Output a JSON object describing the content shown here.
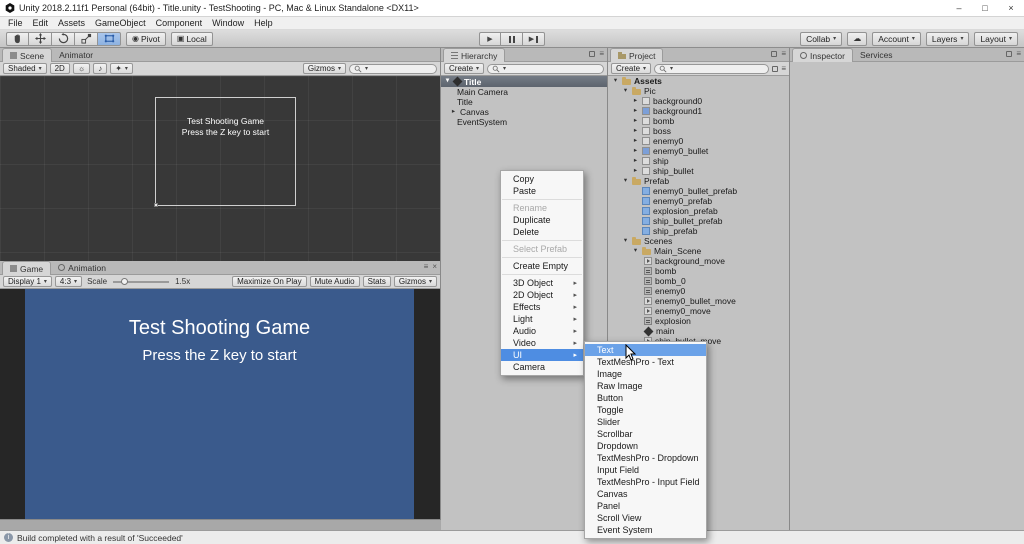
{
  "window": {
    "title": "Unity 2018.2.11f1 Personal (64bit) - Title.unity - TestShooting - PC, Mac & Linux Standalone <DX11>"
  },
  "menubar": {
    "items": [
      "File",
      "Edit",
      "Assets",
      "GameObject",
      "Component",
      "Window",
      "Help"
    ]
  },
  "toolbar": {
    "pivot_label": "Pivot",
    "local_label": "Local",
    "collab_label": "Collab",
    "account_label": "Account",
    "layers_label": "Layers",
    "layout_label": "Layout"
  },
  "scene_panel": {
    "tab": "Scene",
    "animator_tab": "Animator",
    "shaded_label": "Shaded",
    "mode_2d": "2D",
    "gizmos_label": "Gizmos",
    "overlay": {
      "line1": "Test Shooting Game",
      "line2": "Press the Z key to start"
    }
  },
  "game_panel": {
    "tab": "Game",
    "animation_tab": "Animation",
    "display_label": "Display 1",
    "aspect_label": "4:3",
    "scale_label": "Scale",
    "scale_value": "1.5x",
    "maximize_label": "Maximize On Play",
    "mute_label": "Mute Audio",
    "stats_label": "Stats",
    "gizmos_label": "Gizmos",
    "view": {
      "line1": "Test Shooting Game",
      "line2": "Press the Z key to start",
      "bg_color": "#3a5a8c"
    }
  },
  "hierarchy_panel": {
    "tab": "Hierarchy",
    "create_label": "Create",
    "scene_row": "Title",
    "items": [
      {
        "label": "Main Camera"
      },
      {
        "label": "Title"
      },
      {
        "label": "Canvas"
      },
      {
        "label": "EventSystem"
      }
    ]
  },
  "project_panel": {
    "tab": "Project",
    "create_label": "Create",
    "rows": [
      {
        "label": "Assets"
      },
      {
        "label": "Pic"
      },
      {
        "label": "background0"
      },
      {
        "label": "background1"
      },
      {
        "label": "bomb"
      },
      {
        "label": "boss"
      },
      {
        "label": "enemy0"
      },
      {
        "label": "enemy0_bullet"
      },
      {
        "label": "ship"
      },
      {
        "label": "ship_bullet"
      },
      {
        "label": "Prefab"
      },
      {
        "label": "enemy0_bullet_prefab"
      },
      {
        "label": "enemy0_prefab"
      },
      {
        "label": "explosion_prefab"
      },
      {
        "label": "ship_bullet_prefab"
      },
      {
        "label": "ship_prefab"
      },
      {
        "label": "Scenes"
      },
      {
        "label": "Main_Scene"
      },
      {
        "label": "background_move"
      },
      {
        "label": "bomb"
      },
      {
        "label": "bomb_0"
      },
      {
        "label": "enemy0"
      },
      {
        "label": "enemy0_bullet_move"
      },
      {
        "label": "enemy0_move"
      },
      {
        "label": "explosion"
      },
      {
        "label": "main"
      },
      {
        "label": "ship_bullet_move"
      }
    ]
  },
  "inspector_panel": {
    "tab": "Inspector",
    "services_tab": "Services"
  },
  "context_menu": {
    "items": [
      {
        "label": "Copy"
      },
      {
        "label": "Paste"
      },
      {
        "label": "Rename",
        "disabled": true
      },
      {
        "label": "Duplicate"
      },
      {
        "label": "Delete"
      },
      {
        "label": "Select Prefab",
        "disabled": true
      },
      {
        "label": "Create Empty"
      },
      {
        "label": "3D Object",
        "submenu": true
      },
      {
        "label": "2D Object",
        "submenu": true
      },
      {
        "label": "Effects",
        "submenu": true
      },
      {
        "label": "Light",
        "submenu": true
      },
      {
        "label": "Audio",
        "submenu": true
      },
      {
        "label": "Video",
        "submenu": true
      },
      {
        "label": "UI",
        "submenu": true,
        "selected": true
      },
      {
        "label": "Camera"
      }
    ]
  },
  "ui_submenu": {
    "items": [
      {
        "label": "Text",
        "hovered": true
      },
      {
        "label": "TextMeshPro - Text"
      },
      {
        "label": "Image"
      },
      {
        "label": "Raw Image"
      },
      {
        "label": "Button"
      },
      {
        "label": "Toggle"
      },
      {
        "label": "Slider"
      },
      {
        "label": "Scrollbar"
      },
      {
        "label": "Dropdown"
      },
      {
        "label": "TextMeshPro - Dropdown"
      },
      {
        "label": "Input Field"
      },
      {
        "label": "TextMeshPro - Input Field"
      },
      {
        "label": "Canvas"
      },
      {
        "label": "Panel"
      },
      {
        "label": "Scroll View"
      },
      {
        "label": "Event System"
      }
    ]
  },
  "status_bar": {
    "message": "Build completed with a result of 'Succeeded'"
  },
  "icons": {
    "dd": "▾",
    "open": "▾",
    "closed": "▸",
    "submenu": "▸",
    "play": "▶",
    "cloud": "☁",
    "menu": "≡",
    "close": "×",
    "minimize": "–",
    "maximize": "□",
    "sun": "☼",
    "note": "♪",
    "star": "✦",
    "pivot": "◉",
    "local": "▣",
    "info": "i"
  },
  "colors": {
    "selection_blue": "#4e8de2",
    "game_bg": "#3a5a8c"
  }
}
